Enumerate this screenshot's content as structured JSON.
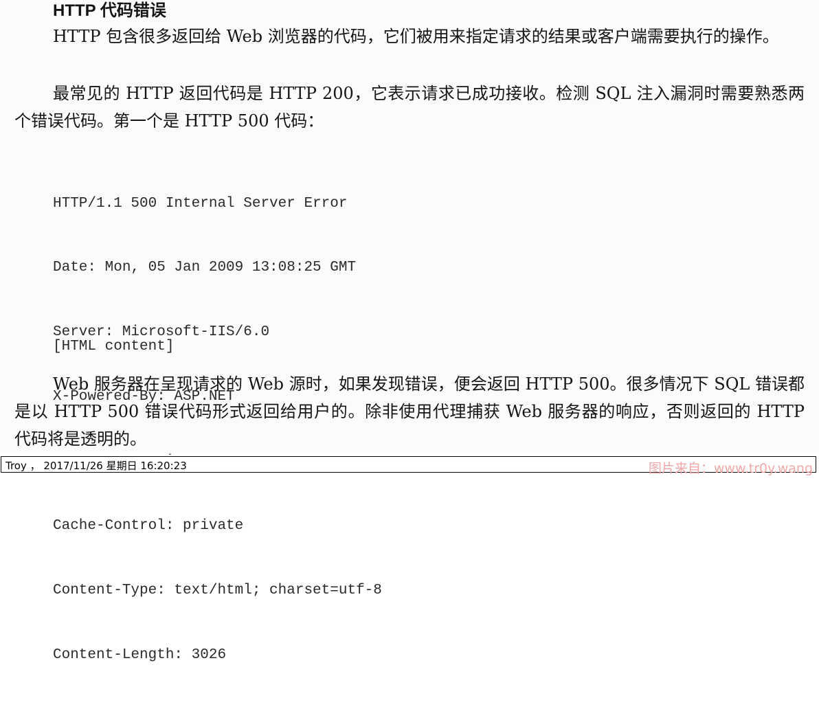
{
  "heading": "HTTP 代码错误",
  "paragraphs": {
    "p1": "HTTP 包含很多返回给 Web 浏览器的代码，它们被用来指定请求的结果或客户端需要执行的操作。",
    "p2": "最常见的 HTTP 返回代码是 HTTP 200，它表示请求已成功接收。检测 SQL 注入漏洞时需要熟悉两个错误代码。第一个是 HTTP 500 代码：",
    "p3": "Web 服务器在呈现请求的 Web 源时，如果发现错误，便会返回 HTTP 500。很多情况下 SQL 错误都是以 HTTP 500 错误代码形式返回给用户的。除非使用代理捕获 Web 服务器的响应，否则返回的 HTTP 代码将是透明的。"
  },
  "code": {
    "lines": [
      "HTTP/1.1 500 Internal Server Error",
      "Date: Mon, 05 Jan 2009 13:08:25 GMT",
      "Server: Microsoft-IIS/6.0",
      "X-Powered-By: ASP.NET",
      "X-AspNet-Version: 1.1.4322",
      "Cache-Control: private",
      "Content-Type: text/html; charset=utf-8",
      "Content-Length: 3026"
    ],
    "extra": "[HTML content]"
  },
  "footer": {
    "stamp": "Troy ， 2017/11/26 星期日 16:20:23",
    "source": "图片来自：www.tr0y.wang"
  }
}
